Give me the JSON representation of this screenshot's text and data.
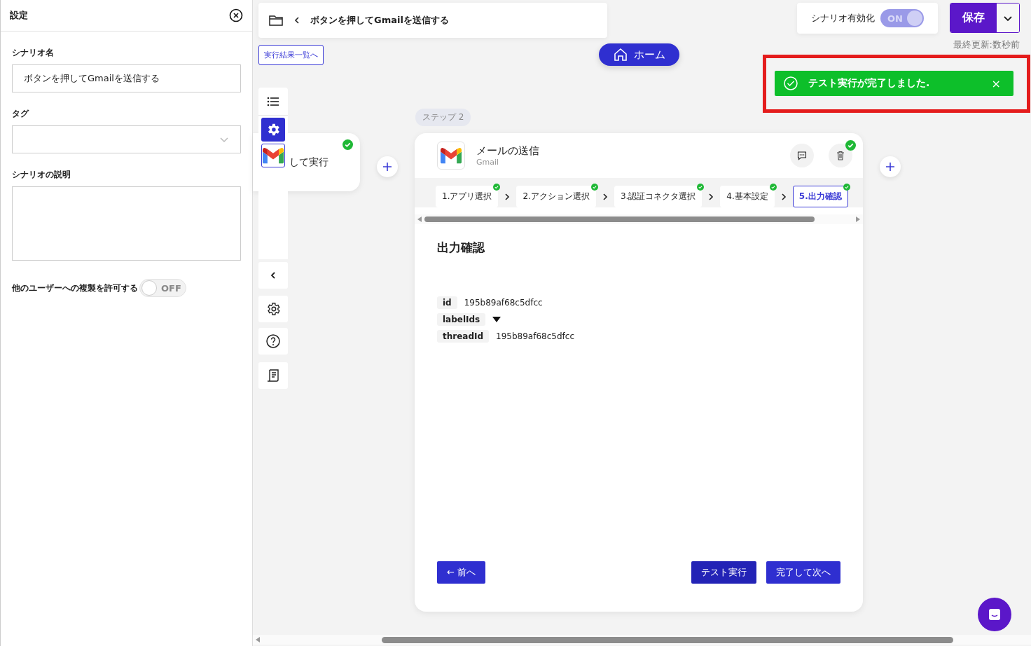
{
  "settings_panel": {
    "title": "設定",
    "fields": [
      {
        "label": "シナリオ名",
        "kind": "text",
        "value": "ボタンを押してGmailを送信する"
      },
      {
        "label": "タグ",
        "kind": "select"
      },
      {
        "label": "シナリオの説明",
        "kind": "textarea"
      }
    ],
    "copy_toggle": {
      "label": "他のユーザーへの複製を許可する",
      "on": false,
      "state_text": "OFF"
    }
  },
  "header": {
    "breadcrumb_title": "ボタンを押してGmailを送信する",
    "results_link": "実行結果一覧へ",
    "home_button": "ホーム",
    "enable_toggle": {
      "label": "シナリオ有効化",
      "on": true,
      "state_text": "ON"
    },
    "save_button": "保存",
    "last_updated": "最終更新:数秒前"
  },
  "toast": {
    "message": "テスト実行が完了しました.",
    "close": "×"
  },
  "trigger_node": {
    "title_fragment": "して実行",
    "done": true
  },
  "step": {
    "badge": "ステップ 2",
    "title": "メールの送信",
    "app": "Gmail",
    "done": true,
    "tabs": [
      {
        "label": "1.アプリ選択",
        "done": true,
        "selected": false
      },
      {
        "label": "2.アクション選択",
        "done": true,
        "selected": false
      },
      {
        "label": "3.認証コネクタ選択",
        "done": true,
        "selected": false
      },
      {
        "label": "4.基本設定",
        "done": true,
        "selected": false
      },
      {
        "label": "5.出力確認",
        "done": true,
        "selected": true
      }
    ],
    "section_title": "出力確認",
    "outputs": [
      {
        "key": "id",
        "kind": "value",
        "value": "195b89af68c5dfcc"
      },
      {
        "key": "labelIds",
        "kind": "expandable",
        "expanded": false
      },
      {
        "key": "threadId",
        "kind": "value",
        "value": "195b89af68c5dfcc"
      }
    ],
    "prev_button": "← 前へ",
    "test_button": "テスト実行",
    "next_button": "完了して次へ"
  }
}
